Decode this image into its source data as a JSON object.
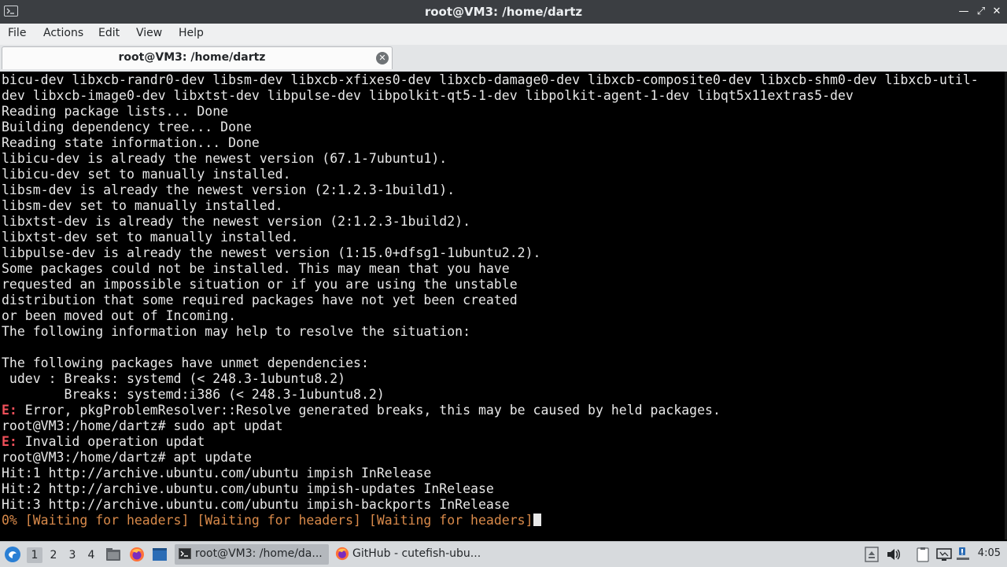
{
  "window": {
    "title": "root@VM3: /home/dartz"
  },
  "menu": [
    "File",
    "Actions",
    "Edit",
    "View",
    "Help"
  ],
  "tab": {
    "title": "root@VM3: /home/dartz"
  },
  "terminal": {
    "lines": [
      "bicu-dev libxcb-randr0-dev libsm-dev libxcb-xfixes0-dev libxcb-damage0-dev libxcb-composite0-dev libxcb-shm0-dev libxcb-util-",
      "dev libxcb-image0-dev libxtst-dev libpulse-dev libpolkit-qt5-1-dev libpolkit-agent-1-dev libqt5x11extras5-dev",
      "Reading package lists... Done",
      "Building dependency tree... Done",
      "Reading state information... Done",
      "libicu-dev is already the newest version (67.1-7ubuntu1).",
      "libicu-dev set to manually installed.",
      "libsm-dev is already the newest version (2:1.2.3-1build1).",
      "libsm-dev set to manually installed.",
      "libxtst-dev is already the newest version (2:1.2.3-1build2).",
      "libxtst-dev set to manually installed.",
      "libpulse-dev is already the newest version (1:15.0+dfsg1-1ubuntu2.2).",
      "Some packages could not be installed. This may mean that you have",
      "requested an impossible situation or if you are using the unstable",
      "distribution that some required packages have not yet been created",
      "or been moved out of Incoming.",
      "The following information may help to resolve the situation:",
      "",
      "The following packages have unmet dependencies:",
      " udev : Breaks: systemd (< 248.3-1ubuntu8.2)",
      "        Breaks: systemd:i386 (< 248.3-1ubuntu8.2)",
      "E:",
      " Error, pkgProblemResolver::Resolve generated breaks, this may be caused by held packages.",
      "root@VM3:/home/dartz# sudo apt updat",
      "E:",
      " Invalid operation updat",
      "root@VM3:/home/dartz# apt update",
      "Hit:1 http://archive.ubuntu.com/ubuntu impish InRelease",
      "Hit:2 http://archive.ubuntu.com/ubuntu impish-updates InRelease",
      "Hit:3 http://archive.ubuntu.com/ubuntu impish-backports InRelease",
      "0% [Waiting for headers] [Waiting for headers] [Waiting for headers]"
    ]
  },
  "taskbar": {
    "workspaces": [
      "1",
      "2",
      "3",
      "4"
    ],
    "tasks": [
      {
        "label": "root@VM3: /home/da...",
        "icon": "terminal-icon"
      },
      {
        "label": "GitHub - cutefish-ubu...",
        "icon": "firefox-icon"
      }
    ],
    "clock": "4:05"
  },
  "colors": {
    "error_prefix": "#f0505a",
    "progress": "#d98a4a",
    "titlebar": "#3b3e42",
    "taskbar": "#d7dadd"
  }
}
